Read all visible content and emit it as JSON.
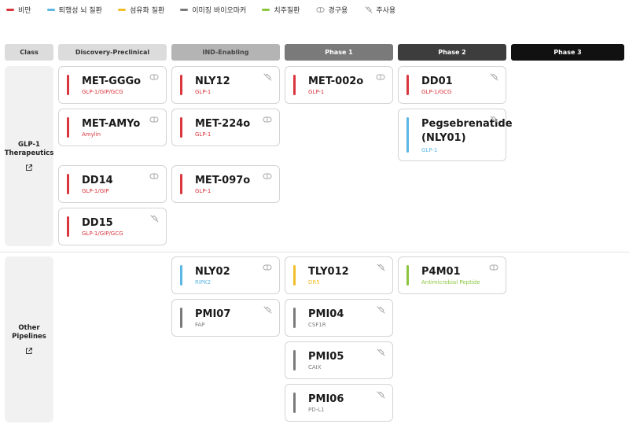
{
  "legend": [
    {
      "type": "dash",
      "label": "비만",
      "color": "#d9363e"
    },
    {
      "type": "dash",
      "label": "퇴행성 뇌 질환",
      "color": "#5bb8e4"
    },
    {
      "type": "dash",
      "label": "섬유화 질환",
      "color": "#f2bf2c"
    },
    {
      "type": "dash",
      "label": "이미징 바이오마커",
      "color": "#7a7a7a"
    },
    {
      "type": "dash",
      "label": "치주질환",
      "color": "#8cc63f"
    },
    {
      "type": "icon",
      "label": "경구용",
      "icon": "pill-icon"
    },
    {
      "type": "icon",
      "label": "주사용",
      "icon": "syringe-icon"
    }
  ],
  "headers": [
    {
      "label": "Class",
      "bg": "#dcdcdc",
      "fg": "#333333"
    },
    {
      "label": "Discovery-Preclinical",
      "bg": "#dcdcdc",
      "fg": "#333333"
    },
    {
      "label": "IND-Enabling",
      "bg": "#b4b4b4",
      "fg": "#444444"
    },
    {
      "label": "Phase 1",
      "bg": "#7a7a7a",
      "fg": "#ffffff"
    },
    {
      "label": "Phase 2",
      "bg": "#3d3d3d",
      "fg": "#ffffff"
    },
    {
      "label": "Phase 3",
      "bg": "#111111",
      "fg": "#ffffff"
    }
  ],
  "classes": [
    {
      "label": "GLP-1\nTherapeutics",
      "icon": "external-link-icon"
    },
    {
      "label": "Other\nPipelines",
      "icon": "external-link-icon"
    }
  ],
  "cards": [
    {
      "name": "MET-GGGo",
      "target": "GLP-1/GIP/GCG",
      "color": "#d9363e",
      "icon": "pill-icon"
    },
    {
      "name": "MET-AMYo",
      "target": "Amylin",
      "color": "#d9363e",
      "icon": "pill-icon"
    },
    {
      "name": "DD14",
      "target": "GLP-1/GIP",
      "color": "#d9363e",
      "icon": "pill-icon"
    },
    {
      "name": "DD15",
      "target": "GLP-1/GIP/GCG",
      "color": "#d9363e",
      "icon": "syringe-icon"
    },
    {
      "name": "NLY12",
      "target": "GLP-1",
      "color": "#d9363e",
      "icon": "syringe-icon"
    },
    {
      "name": "MET-224o",
      "target": "GLP-1",
      "color": "#d9363e",
      "icon": "pill-icon"
    },
    {
      "name": "MET-097o",
      "target": "GLP-1",
      "color": "#d9363e",
      "icon": "pill-icon"
    },
    {
      "name": "MET-002o",
      "target": "GLP-1",
      "color": "#d9363e",
      "icon": "pill-icon"
    },
    {
      "name": "DD01",
      "target": "GLP-1/GCG",
      "color": "#d9363e",
      "icon": "syringe-icon"
    },
    {
      "name": "Pegsebrenatide\n(NLY01)",
      "target": "GLP-1",
      "color": "#5bb8e4",
      "icon": "syringe-icon"
    },
    {
      "name": "NLY02",
      "target": "RIPK2",
      "color": "#5bb8e4",
      "icon": "pill-icon"
    },
    {
      "name": "PMI07",
      "target": "FAP",
      "color": "#7a7a7a",
      "icon": "syringe-icon"
    },
    {
      "name": "TLY012",
      "target": "DR5",
      "color": "#f2bf2c",
      "icon": "syringe-icon"
    },
    {
      "name": "PMI04",
      "target": "CSF1R",
      "color": "#7a7a7a",
      "icon": "syringe-icon"
    },
    {
      "name": "PMI05",
      "target": "CAIX",
      "color": "#7a7a7a",
      "icon": "syringe-icon"
    },
    {
      "name": "PMI06",
      "target": "PD-L1",
      "color": "#7a7a7a",
      "icon": "syringe-icon"
    },
    {
      "name": "P4M01",
      "target": "Antimicrobial Peptide",
      "color": "#8cc63f",
      "icon": "pill-icon"
    }
  ]
}
